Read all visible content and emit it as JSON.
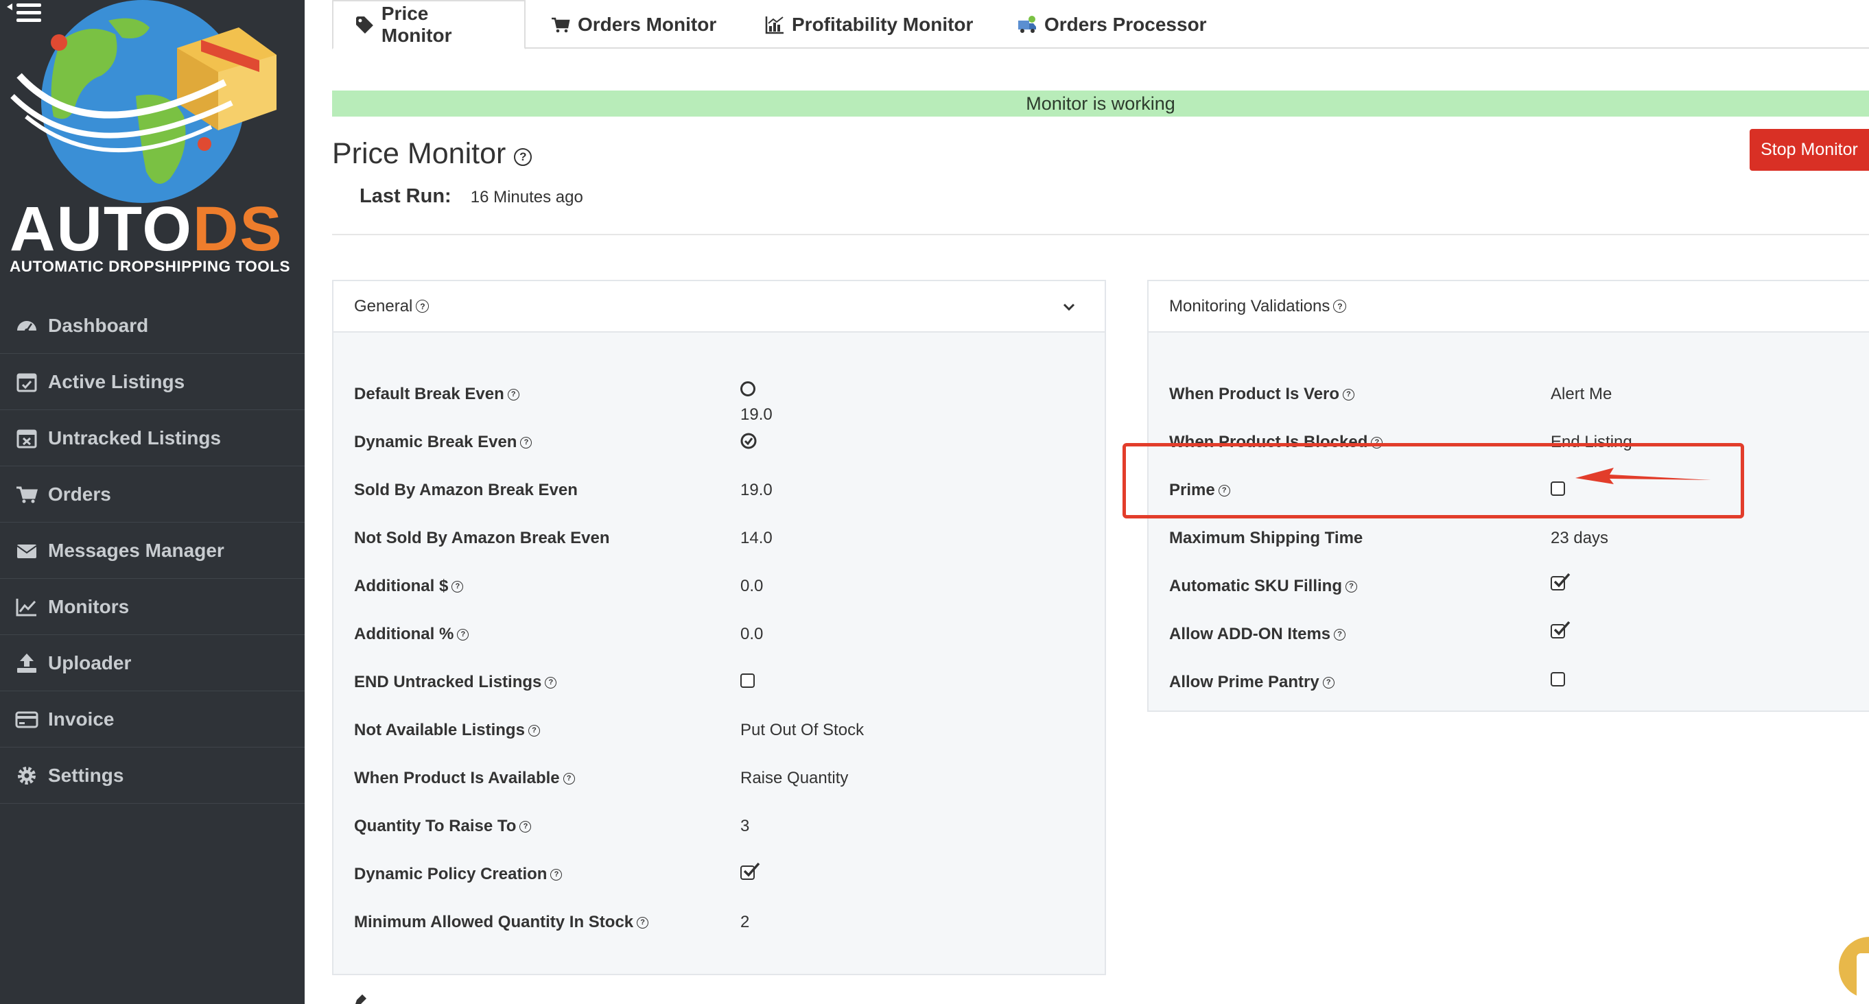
{
  "brand": {
    "name_main": "AUTO",
    "name_accent": "DS",
    "tagline": "AUTOMATIC DROPSHIPPING TOOLS",
    "accent_color": "#ee7d2c"
  },
  "sidebar": {
    "items": [
      {
        "label": "Dashboard",
        "icon": "dashboard-gauge-icon"
      },
      {
        "label": "Active Listings",
        "icon": "calendar-check-icon"
      },
      {
        "label": "Untracked Listings",
        "icon": "calendar-x-icon"
      },
      {
        "label": "Orders",
        "icon": "cart-icon"
      },
      {
        "label": "Messages Manager",
        "icon": "envelope-icon"
      },
      {
        "label": "Monitors",
        "icon": "line-chart-icon"
      },
      {
        "label": "Uploader",
        "icon": "upload-icon"
      },
      {
        "label": "Invoice",
        "icon": "credit-card-icon"
      },
      {
        "label": "Settings",
        "icon": "gear-icon"
      }
    ]
  },
  "tabs": [
    {
      "label": "Price Monitor",
      "icon": "tag-icon",
      "active": true
    },
    {
      "label": "Orders Monitor",
      "icon": "cart-icon",
      "active": false
    },
    {
      "label": "Profitability Monitor",
      "icon": "bar-chart-icon",
      "active": false
    },
    {
      "label": "Orders Processor",
      "icon": "truck-icon",
      "active": false
    }
  ],
  "status": {
    "banner": "Monitor is working",
    "banner_color": "#b8ecb9"
  },
  "header": {
    "title": "Price Monitor",
    "last_run_label": "Last Run:",
    "last_run_value": "16 Minutes ago",
    "stop_button": "Stop Monitor",
    "stop_color": "#d93025"
  },
  "general": {
    "title": "General",
    "rows": [
      {
        "label": "Default Break Even",
        "help": true,
        "value": "19.0",
        "control": "radio-empty"
      },
      {
        "label": "Dynamic Break Even",
        "help": true,
        "value": "",
        "control": "radio-checked"
      },
      {
        "label": "Sold By Amazon Break Even",
        "help": false,
        "value": "19.0"
      },
      {
        "label": "Not Sold By Amazon Break Even",
        "help": false,
        "value": "14.0"
      },
      {
        "label": "Additional $",
        "help": true,
        "value": "0.0"
      },
      {
        "label": "Additional %",
        "help": true,
        "value": "0.0"
      },
      {
        "label": "END Untracked Listings",
        "help": true,
        "value": "",
        "control": "checkbox",
        "checked": false
      },
      {
        "label": "Not Available Listings",
        "help": true,
        "value": "Put Out Of Stock"
      },
      {
        "label": "When Product Is Available",
        "help": true,
        "value": "Raise Quantity"
      },
      {
        "label": "Quantity To Raise To",
        "help": true,
        "value": "3"
      },
      {
        "label": "Dynamic Policy Creation",
        "help": true,
        "value": "",
        "control": "checkbox",
        "checked": true
      },
      {
        "label": "Minimum Allowed Quantity In Stock",
        "help": true,
        "value": "2"
      }
    ]
  },
  "validations": {
    "title": "Monitoring Validations",
    "rows": [
      {
        "label": "When Product Is Vero",
        "help": true,
        "value": "Alert Me"
      },
      {
        "label": "When Product Is Blocked",
        "help": true,
        "value": "End Listing"
      },
      {
        "label": "Prime",
        "help": true,
        "value": "",
        "control": "checkbox",
        "checked": false
      },
      {
        "label": "Maximum Shipping Time",
        "help": false,
        "value": "23 days"
      },
      {
        "label": "Automatic SKU Filling",
        "help": true,
        "value": "",
        "control": "checkbox",
        "checked": true
      },
      {
        "label": "Allow ADD-ON Items",
        "help": true,
        "value": "",
        "control": "checkbox",
        "checked": true
      },
      {
        "label": "Allow Prime Pantry",
        "help": true,
        "value": "",
        "control": "checkbox",
        "checked": false
      }
    ]
  },
  "annotation": {
    "color": "#e23d2b"
  }
}
